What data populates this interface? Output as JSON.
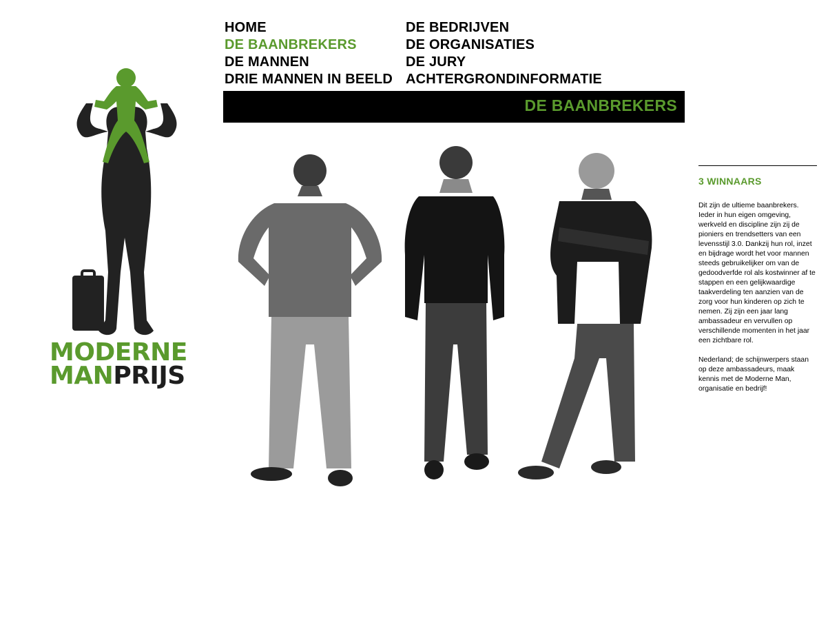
{
  "logo": {
    "line1": "MODERNE",
    "line2_green": "MAN",
    "line2_dark": "PRIJS"
  },
  "nav": {
    "col1": [
      "HOME",
      "DE BAANBREKERS",
      "DE MANNEN",
      "DRIE MANNEN IN BEELD"
    ],
    "col2": [
      "DE BEDRIJVEN",
      "DE ORGANISATIES",
      "DE JURY",
      "ACHTERGRONDINFORMATIE"
    ],
    "active": "DE BAANBREKERS"
  },
  "banner": {
    "title": "DE BAANBREKERS"
  },
  "sidebar": {
    "heading": "3 WINNAARS",
    "paragraph1": "Dit zijn de ultieme baanbrekers. Ieder in hun eigen omgeving, werkveld en discipline zijn zij de pioniers en trendsetters van een levensstijl 3.0. Dankzij hun rol, inzet en bijdrage wordt het voor mannen steeds gebruikelijker om van de gedoodverfde rol als kostwinner af te stappen en een gelijkwaardige taakverdeling ten aanzien van de zorg voor hun kinderen op zich te nemen. Zij zijn een jaar lang ambassadeur en vervullen op verschillende momenten in het jaar een zichtbare rol.",
    "paragraph2": "Nederland; de schijnwerpers staan op deze ambassadeurs, maak kennis met de Moderne Man, organisatie en bedrijf!"
  },
  "colors": {
    "accent": "#5a9a2d",
    "banner_bg": "#000000"
  },
  "icons": [
    "father-child-silhouette-icon",
    "person-photo-icon"
  ]
}
